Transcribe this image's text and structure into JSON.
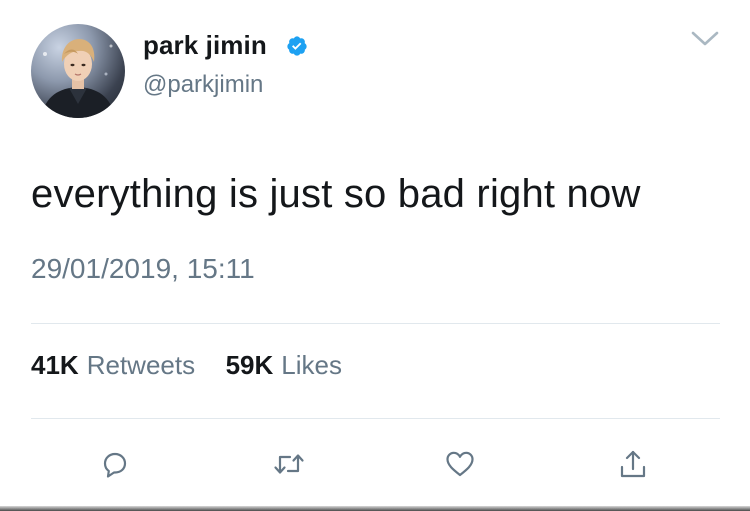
{
  "user": {
    "display_name": "park jimin",
    "handle": "@parkjimin",
    "verified": true
  },
  "tweet": {
    "text": "everything is just so bad right now",
    "timestamp": "29/01/2019, 15:11"
  },
  "stats": {
    "retweets_count": "41K",
    "retweets_label": "Retweets",
    "likes_count": "59K",
    "likes_label": "Likes"
  },
  "actions": [
    {
      "icon": "reply-icon"
    },
    {
      "icon": "retweet-icon"
    },
    {
      "icon": "heart-icon"
    },
    {
      "icon": "share-icon"
    }
  ],
  "colors": {
    "verified_blue": "#1da1f2",
    "primary_text": "#14171a",
    "secondary_text": "#657786",
    "divider": "#e1e8ed"
  }
}
